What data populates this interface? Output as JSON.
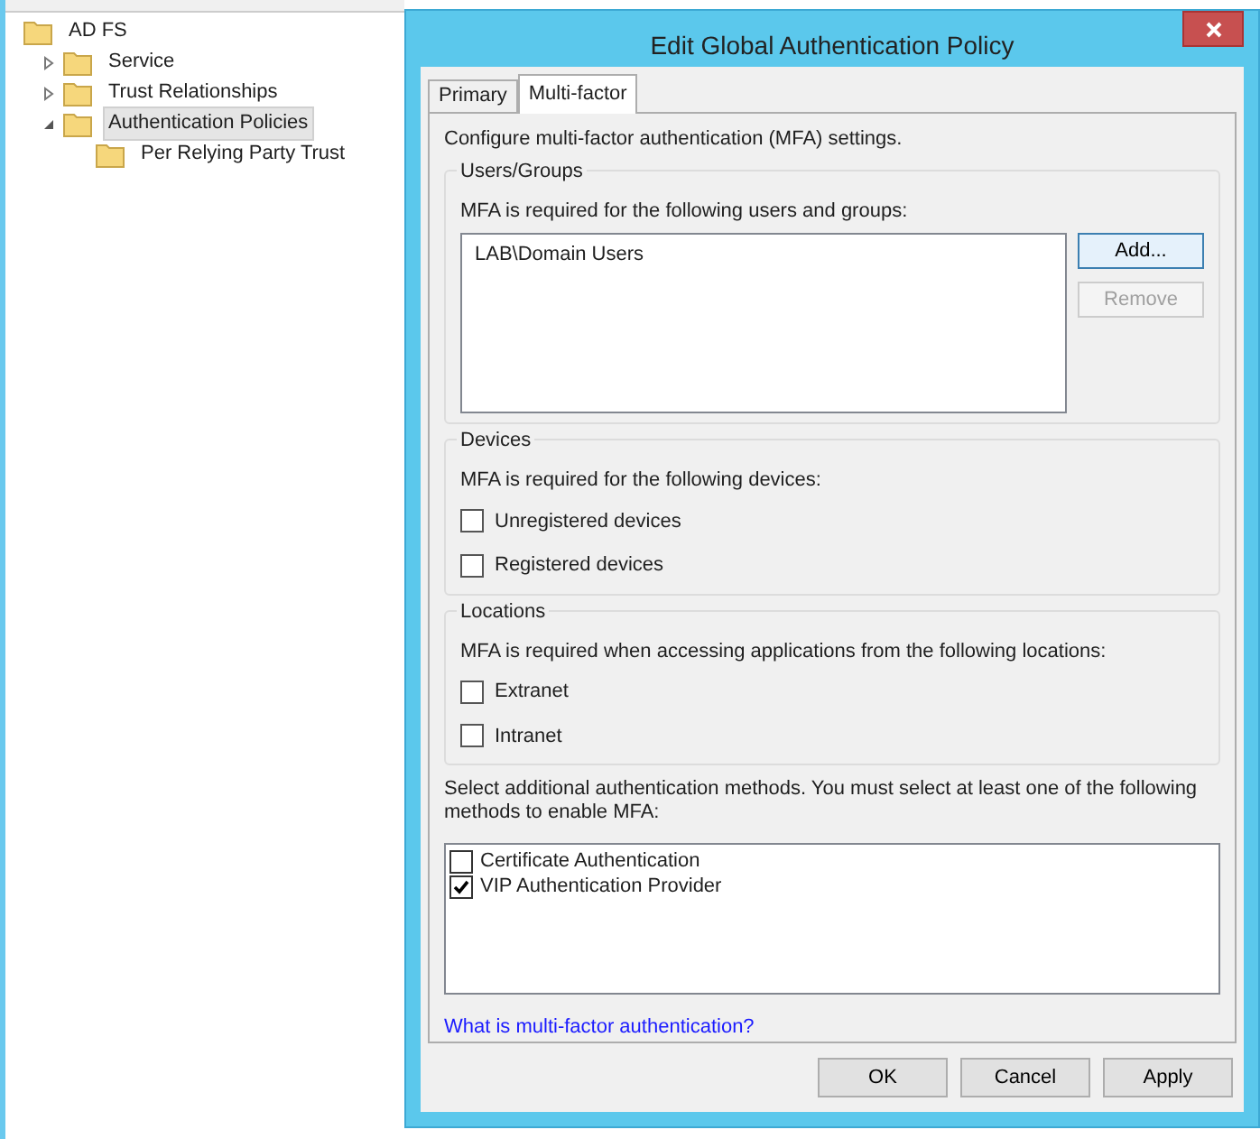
{
  "tree": [
    {
      "label": "AD FS",
      "selected": false,
      "children": [
        {
          "label": "Service",
          "selected": false,
          "expanded": false
        },
        {
          "label": "Trust Relationships",
          "selected": false,
          "expanded": false
        },
        {
          "label": "Authentication Policies",
          "selected": true,
          "expanded": true,
          "children": [
            {
              "label": "Per Relying Party Trust",
              "selected": false
            }
          ]
        }
      ]
    }
  ],
  "dialog": {
    "title": "Edit Global Authentication Policy",
    "tabs": [
      {
        "label": "Primary",
        "selected": false
      },
      {
        "label": "Multi-factor",
        "selected": true
      }
    ],
    "intro": "Configure multi-factor authentication (MFA) settings.",
    "users_groups": {
      "title": "Users/Groups",
      "description": "MFA is required for the following users and groups:",
      "items": [
        "LAB\\Domain Users"
      ],
      "buttons": [
        {
          "label": "Add...",
          "disabled": false
        },
        {
          "label": "Remove",
          "disabled": true
        }
      ]
    },
    "devices": {
      "title": "Devices",
      "description": "MFA is required for the following devices:",
      "options": [
        {
          "label": "Unregistered devices",
          "checked": false
        },
        {
          "label": "Registered devices",
          "checked": false
        }
      ]
    },
    "locations": {
      "title": "Locations",
      "description": "MFA is required when accessing applications from the following locations:",
      "options": [
        {
          "label": "Extranet",
          "checked": false
        },
        {
          "label": "Intranet",
          "checked": false
        }
      ]
    },
    "methods_text": "Select additional authentication methods. You must select at least one of the following methods to enable MFA:",
    "methods": [
      {
        "label": "Certificate Authentication",
        "checked": false
      },
      {
        "label": "VIP Authentication Provider",
        "checked": true
      }
    ],
    "link": "What is multi-factor authentication?",
    "footer_buttons": [
      "OK",
      "Cancel",
      "Apply"
    ]
  }
}
